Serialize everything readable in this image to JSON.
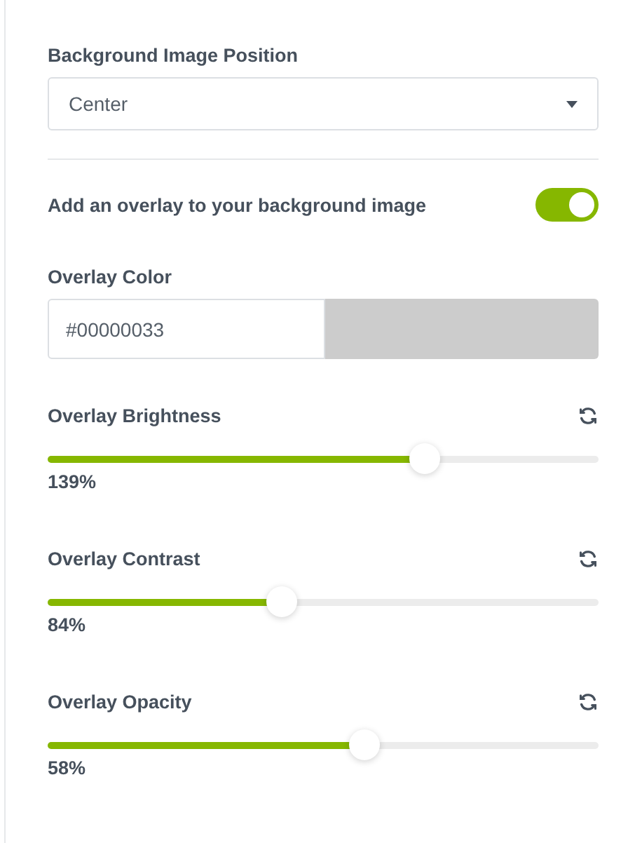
{
  "position": {
    "label": "Background Image Position",
    "value": "Center"
  },
  "overlay_toggle": {
    "label": "Add an overlay to your background image",
    "on": true
  },
  "overlay_color": {
    "label": "Overlay Color",
    "value": "#00000033",
    "color": "#cccccc"
  },
  "sliders": [
    {
      "label": "Overlay Brightness",
      "level": 0.684,
      "reading": "139%"
    },
    {
      "label": "Overlay Contrast",
      "level": 0.425,
      "reading": "84%"
    },
    {
      "label": "Overlay Opacity",
      "level": 0.575,
      "reading": "58%"
    }
  ]
}
